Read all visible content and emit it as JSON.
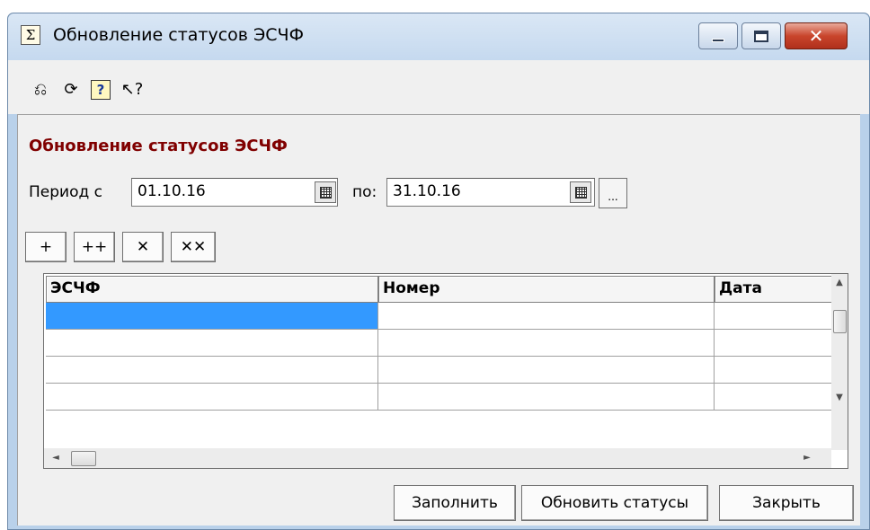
{
  "window": {
    "title": "Обновление статусов ЭСЧФ",
    "app_icon_glyph": "Σ",
    "close_glyph": "✕"
  },
  "toolbar": {
    "icons": [
      "undo-icon",
      "redo-icon",
      "help-icon",
      "context-help-icon"
    ],
    "glyphs": [
      "⎌",
      "⟳",
      "?",
      "↖?"
    ]
  },
  "form": {
    "title": "Обновление статусов ЭСЧФ",
    "period_from_label": "Период с",
    "period_from_value": "01.10.16",
    "period_to_label": "по:",
    "period_to_value": "31.10.16",
    "dots": "..."
  },
  "grid_buttons": {
    "add": "+",
    "add_all": "++",
    "remove": "✕",
    "remove_all": "✕✕"
  },
  "table": {
    "columns": [
      "ЭСЧФ",
      "Номер",
      "Дата"
    ],
    "rows": [
      [
        "",
        "",
        ""
      ],
      [
        "",
        "",
        ""
      ],
      [
        "",
        "",
        ""
      ],
      [
        "",
        "",
        ""
      ]
    ],
    "arrow_up": "▲",
    "arrow_down": "▼",
    "arrow_left": "◄",
    "arrow_right": "►"
  },
  "buttons": {
    "fill": "Заполнить",
    "update_statuses": "Обновить статусы",
    "close": "Закрыть"
  },
  "colors": {
    "section_title": "#800000",
    "selected_cell": "#3399ff"
  }
}
